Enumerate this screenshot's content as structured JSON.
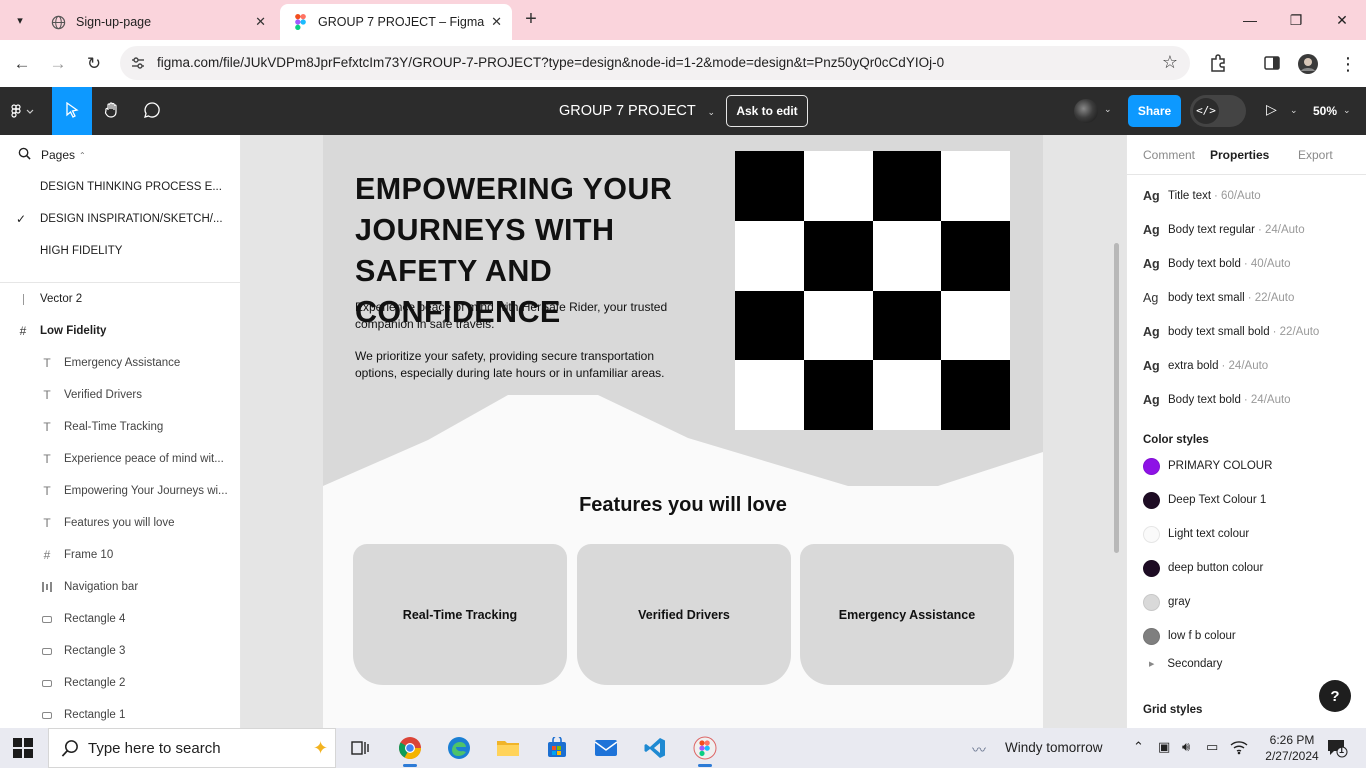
{
  "browser": {
    "tabs": [
      {
        "title": "Sign-up-page",
        "active": false
      },
      {
        "title": "GROUP 7 PROJECT – Figma",
        "active": true
      }
    ],
    "url": "figma.com/file/JUkVDPm8JprFefxtcIm73Y/GROUP-7-PROJECT?type=design&node-id=1-2&mode=design&t=Pnz50yQr0cCdYIOj-0"
  },
  "toolbar": {
    "file_title": "GROUP 7 PROJECT",
    "ask_to_edit": "Ask to edit",
    "share": "Share",
    "devmode_label": "</>",
    "zoom": "50%"
  },
  "left_panel": {
    "pages_label": "Pages",
    "pages": [
      {
        "name": "DESIGN THINKING PROCESS E...",
        "current": false
      },
      {
        "name": "DESIGN INSPIRATION/SKETCH/...",
        "current": true
      },
      {
        "name": "HIGH FIDELITY",
        "current": false
      }
    ],
    "layers": [
      {
        "name": "Vector 2",
        "icon": "vector-icon",
        "level": "top"
      },
      {
        "name": "Low Fidelity",
        "icon": "frame-icon",
        "level": "top"
      },
      {
        "name": "Emergency Assistance",
        "icon": "text-icon",
        "level": "child"
      },
      {
        "name": "Verified Drivers",
        "icon": "text-icon",
        "level": "child"
      },
      {
        "name": "Real-Time Tracking",
        "icon": "text-icon",
        "level": "child"
      },
      {
        "name": "Experience peace of mind wit...",
        "icon": "text-icon",
        "level": "child"
      },
      {
        "name": "Empowering Your Journeys wi...",
        "icon": "text-icon",
        "level": "child"
      },
      {
        "name": "Features you will love",
        "icon": "text-icon",
        "level": "child"
      },
      {
        "name": "Frame 10",
        "icon": "frame-icon",
        "level": "child"
      },
      {
        "name": "Navigation bar",
        "icon": "autolayout-icon",
        "level": "child"
      },
      {
        "name": "Rectangle 4",
        "icon": "rectangle-icon",
        "level": "child"
      },
      {
        "name": "Rectangle 3",
        "icon": "rectangle-icon",
        "level": "child"
      },
      {
        "name": "Rectangle 2",
        "icon": "rectangle-icon",
        "level": "child"
      },
      {
        "name": "Rectangle 1",
        "icon": "rectangle-icon",
        "level": "child"
      }
    ]
  },
  "canvas": {
    "hero_title": "EMPOWERING YOUR JOURNEYS WITH SAFETY AND CONFIDENCE",
    "hero_paragraph_1": "Experience peace of mind with HerSafe Rider, your trusted companion in safe travels.",
    "hero_paragraph_2": "We prioritize your safety, providing secure transportation options, especially during late hours or in unfamiliar areas.",
    "features_title": "Features you will love",
    "feature_cards": [
      "Real-Time Tracking",
      "Verified Drivers",
      "Emergency Assistance"
    ],
    "colors": {
      "hero_bg": "#d9d9d9",
      "frame_bg": "#fafafa",
      "card_bg": "#d9d9d9",
      "checker_dark": "#000000",
      "checker_light": "#ffffff"
    }
  },
  "right_panel": {
    "tabs": [
      {
        "label": "Comment",
        "active": false
      },
      {
        "label": "Properties",
        "active": true
      },
      {
        "label": "Export",
        "active": false
      }
    ],
    "text_styles": [
      {
        "name": "Title text",
        "meta": "· 60/Auto"
      },
      {
        "name": "Body text regular",
        "meta": "· 24/Auto"
      },
      {
        "name": "Body text bold",
        "meta": "· 40/Auto"
      },
      {
        "name": "body text small",
        "meta": "· 22/Auto"
      },
      {
        "name": "body text small bold",
        "meta": "· 22/Auto"
      },
      {
        "name": "extra bold",
        "meta": "· 24/Auto"
      },
      {
        "name": "Body text bold",
        "meta": "· 24/Auto"
      }
    ],
    "text_style_prefix": "Ag",
    "color_styles_label": "Color styles",
    "color_styles": [
      {
        "name": "PRIMARY COLOUR",
        "color": "#8e12e6"
      },
      {
        "name": "Deep Text Colour 1",
        "color": "#1e0c24"
      },
      {
        "name": "Light text colour",
        "color": "#fafafa"
      },
      {
        "name": "deep button colour",
        "color": "#1e0c24"
      },
      {
        "name": "gray",
        "color": "#d9d9d9"
      },
      {
        "name": "low f b colour",
        "color": "#7f7f7f"
      }
    ],
    "secondary_label": "Secondary",
    "grid_styles_label": "Grid styles",
    "help": "?"
  },
  "taskbar": {
    "search_placeholder": "Type here to search",
    "weather": "Windy tomorrow",
    "time": "6:26 PM",
    "date": "2/27/2024",
    "notification_count": "1"
  }
}
